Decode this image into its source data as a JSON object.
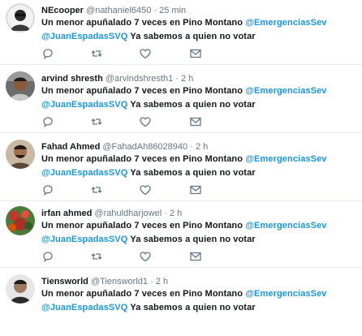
{
  "tweets": [
    {
      "name": "NEcooper",
      "handle": "@nathaniel6450",
      "separator": "·",
      "time": "25 min",
      "text_line1": "Un menor apuñalado 7 veces en Pino Montano",
      "mention1": "@EmergenciasSev",
      "mention2": "@JuanEspadasSVQ",
      "text_line2": "Ya sabemos a quien no votar",
      "avatar_icon": "user-avatar-icon"
    },
    {
      "name": "arvind shresth",
      "handle": "@arvindshresth1",
      "separator": "·",
      "time": "2 h",
      "text_line1": "Un menor apuñalado 7 veces en Pino Montano",
      "mention1": "@EmergenciasSev",
      "mention2": "@JuanEspadasSVQ",
      "text_line2": "Ya sabemos a quien no votar",
      "avatar_icon": "user-avatar-icon"
    },
    {
      "name": "Fahad Ahmed",
      "handle": "@FahadAh86028940",
      "separator": "·",
      "time": "2 h",
      "text_line1": "Un menor apuñalado 7 veces en Pino Montano",
      "mention1": "@EmergenciasSev",
      "mention2": "@JuanEspadasSVQ",
      "text_line2": "Ya sabemos a quien no votar",
      "avatar_icon": "user-avatar-icon"
    },
    {
      "name": "irfan ahmed",
      "handle": "@rahuldharjowel",
      "separator": "·",
      "time": "2 h",
      "text_line1": "Un menor apuñalado 7 veces en Pino Montano",
      "mention1": "@EmergenciasSev",
      "mention2": "@JuanEspadasSVQ",
      "text_line2": "Ya sabemos a quien no votar",
      "avatar_icon": "user-avatar-icon"
    },
    {
      "name": "Tiensworld",
      "handle": "@Tiensworld1",
      "separator": "·",
      "time": "2 h",
      "text_line1": "Un menor apuñalado 7 veces en Pino Montano",
      "mention1": "@EmergenciasSev",
      "mention2": "@JuanEspadasSVQ",
      "text_line2": "Ya sabemos a quien no votar",
      "avatar_icon": "user-avatar-icon"
    }
  ],
  "colors": {
    "text": "#14171a",
    "muted": "#657786",
    "mention": "#1b95e0",
    "divider": "#e6ecf0"
  },
  "icons": [
    "reply-icon",
    "retweet-icon",
    "like-icon",
    "direct-message-icon"
  ]
}
